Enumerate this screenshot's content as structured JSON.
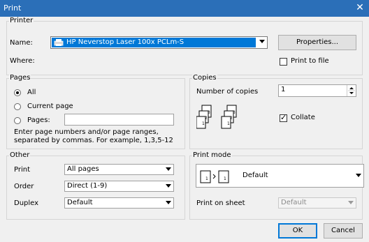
{
  "window": {
    "title": "Print",
    "close_glyph": "✕"
  },
  "printer": {
    "legend": "Printer",
    "name_label": "Name:",
    "name_value": "HP Neverstop Laser 100x PCLm-S",
    "where_label": "Where:",
    "properties_button": "Properties...",
    "print_to_file_label": "Print to file",
    "print_to_file_checked": false
  },
  "pages": {
    "legend": "Pages",
    "all_label": "All",
    "current_page_label": "Current page",
    "pages_label": "Pages:",
    "pages_value": "",
    "selected": "all",
    "hint_line1": "Enter page numbers and/or page ranges,",
    "hint_line2": "separated by commas. For example, 1,3,5-12"
  },
  "copies": {
    "legend": "Copies",
    "number_label": "Number of copies",
    "number_value": "1",
    "collate_label": "Collate",
    "collate_checked": true
  },
  "other": {
    "legend": "Other",
    "print_label": "Print",
    "print_value": "All pages",
    "order_label": "Order",
    "order_value": "Direct (1-9)",
    "duplex_label": "Duplex",
    "duplex_value": "Default"
  },
  "print_mode": {
    "legend": "Print mode",
    "mode_value": "Default",
    "print_on_sheet_label": "Print on sheet",
    "print_on_sheet_value": "Default"
  },
  "footer": {
    "ok_label": "OK",
    "cancel_label": "Cancel"
  },
  "colors": {
    "titlebar": "#2b6fb8",
    "dialog_bg": "#f0f0f0",
    "selection": "#0078d7"
  }
}
